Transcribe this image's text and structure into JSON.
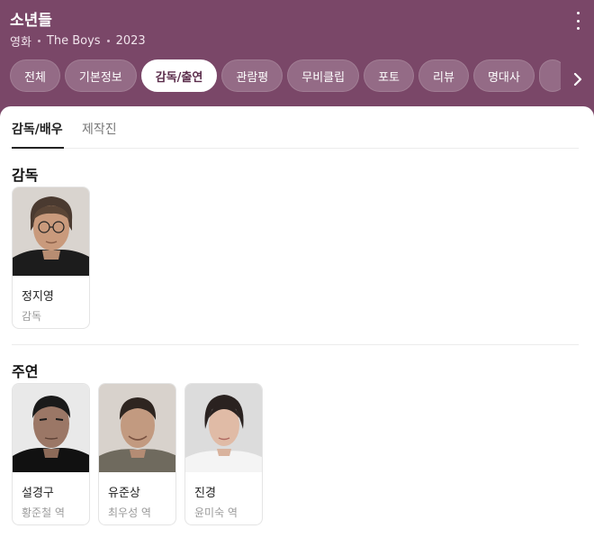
{
  "header": {
    "title": "소년들",
    "meta": [
      "영화",
      "The Boys",
      "2023"
    ]
  },
  "tabs": [
    {
      "label": "전체",
      "active": false
    },
    {
      "label": "기본정보",
      "active": false
    },
    {
      "label": "감독/출연",
      "active": true
    },
    {
      "label": "관람평",
      "active": false
    },
    {
      "label": "무비클립",
      "active": false
    },
    {
      "label": "포토",
      "active": false
    },
    {
      "label": "리뷰",
      "active": false
    },
    {
      "label": "명대사",
      "active": false
    }
  ],
  "subtabs": [
    {
      "label": "감독/배우",
      "active": true
    },
    {
      "label": "제작진",
      "active": false
    }
  ],
  "sections": {
    "director": {
      "title": "감독",
      "people": [
        {
          "name": "정지영",
          "role": "감독"
        }
      ]
    },
    "cast": {
      "title": "주연",
      "people": [
        {
          "name": "설경구",
          "role": "황준철 역"
        },
        {
          "name": "유준상",
          "role": "최우성 역"
        },
        {
          "name": "진경",
          "role": "윤미숙 역"
        }
      ]
    }
  },
  "colors": {
    "header_bg": "#7a4768",
    "active_tab_text": "#5b2d4b"
  },
  "icons": {
    "more": "kebab-menu-icon",
    "next": "chevron-right-icon"
  }
}
